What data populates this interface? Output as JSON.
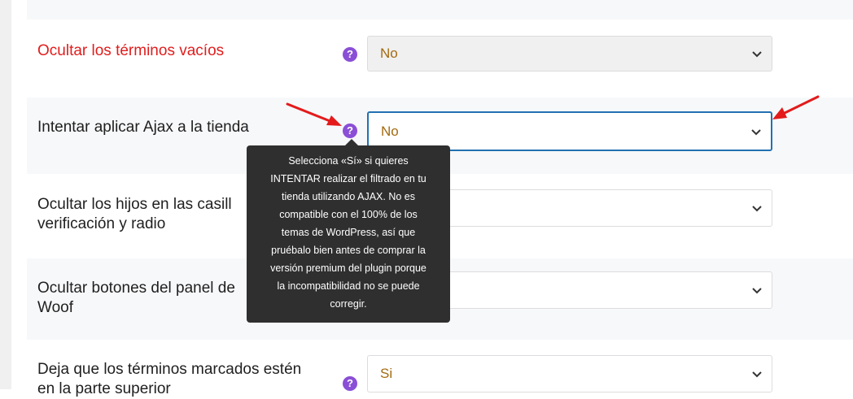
{
  "settings": [
    {
      "label": "Ocultar los términos vacíos",
      "value": "No",
      "help": "?"
    },
    {
      "label": "Intentar aplicar Ajax a la tienda",
      "value": "No",
      "help": "?"
    },
    {
      "label_line1": "Ocultar los hijos en las casill",
      "label_line2": "verificación y radio"
    },
    {
      "label_line1": "Ocultar botones del panel de",
      "label_line2": "Woof"
    },
    {
      "label_line1": "Deja que los términos marcados estén",
      "label_line2": "en la parte superior",
      "value": "Si",
      "help": "?"
    }
  ],
  "tooltip": {
    "lines": [
      "Selecciona «Sí» si quieres",
      "INTENTAR realizar el filtrado en tu",
      "tienda utilizando AJAX. No es",
      "compatible con el 100% de los",
      "temas de WordPress, así que",
      "pruébalo bien antes de comprar la",
      "versión premium del plugin porque",
      "la incompatibilidad no se puede",
      "corregir."
    ]
  },
  "colors": {
    "accent": "#8a4fd6",
    "focus": "#2271b1",
    "warning": "#e11d1d",
    "value": "#a36a10",
    "annotation": "#e31b1b"
  },
  "icons": {
    "help": "question-circle-icon",
    "chevron": "chevron-down-icon",
    "annotation": "red-arrow-icon"
  }
}
